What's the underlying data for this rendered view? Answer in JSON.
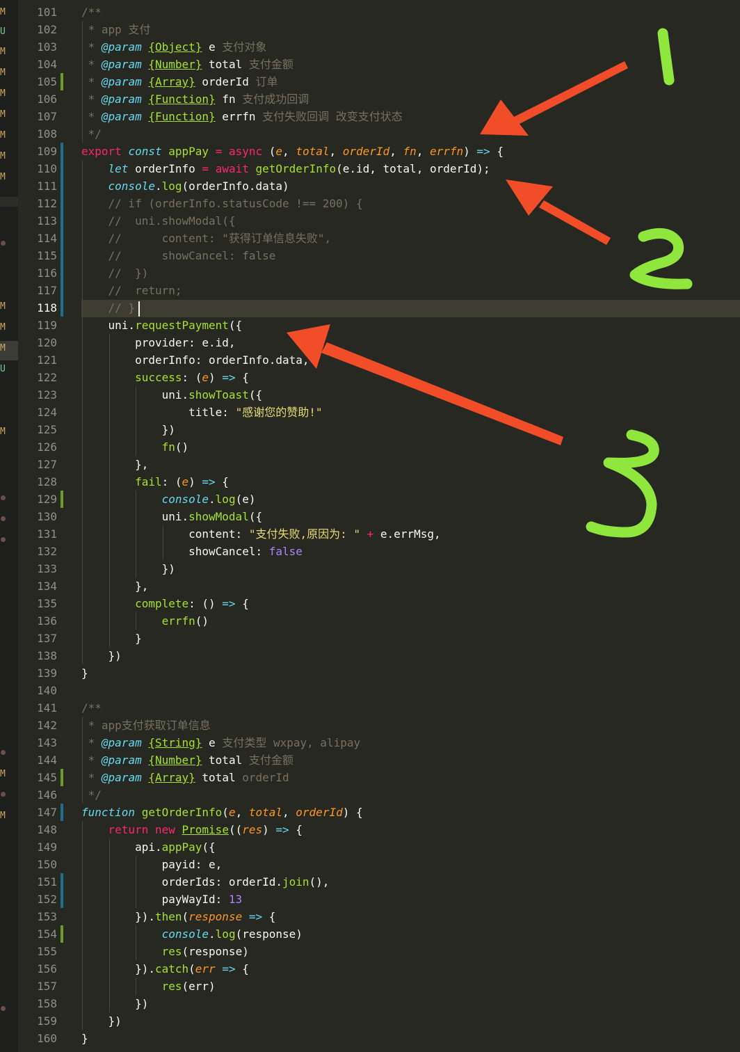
{
  "editor": {
    "active_line": 118,
    "accent_colors": {
      "background": "#272822",
      "keyword": "#f92672",
      "storage": "#66d9ef",
      "function": "#a6e22e",
      "parameter": "#fd971f",
      "string": "#e6db74",
      "number": "#ae81ff",
      "comment": "#75715e"
    },
    "lines": [
      {
        "n": 101,
        "t": [
          [
            "/**",
            "cm"
          ]
        ]
      },
      {
        "n": 102,
        "t": [
          [
            " * app 支付",
            "cm"
          ]
        ]
      },
      {
        "n": 103,
        "t": [
          [
            " * ",
            "cm"
          ],
          [
            "@param",
            "st"
          ],
          [
            " ",
            ""
          ],
          [
            "{Object}",
            "ty"
          ],
          [
            " e ",
            ""
          ],
          [
            "支付对象",
            "cm"
          ]
        ]
      },
      {
        "n": 104,
        "t": [
          [
            " * ",
            "cm"
          ],
          [
            "@param",
            "st"
          ],
          [
            " ",
            ""
          ],
          [
            "{Number}",
            "ty"
          ],
          [
            " total ",
            ""
          ],
          [
            "支付金额",
            "cm"
          ]
        ]
      },
      {
        "n": 105,
        "t": [
          [
            " * ",
            "cm"
          ],
          [
            "@param",
            "st"
          ],
          [
            " ",
            ""
          ],
          [
            "{Array}",
            "ty"
          ],
          [
            " orderId ",
            ""
          ],
          [
            "订单",
            "cm"
          ]
        ]
      },
      {
        "n": 106,
        "t": [
          [
            " * ",
            "cm"
          ],
          [
            "@param",
            "st"
          ],
          [
            " ",
            ""
          ],
          [
            "{Function}",
            "ty"
          ],
          [
            " fn ",
            ""
          ],
          [
            "支付成功回调",
            "cm"
          ]
        ]
      },
      {
        "n": 107,
        "t": [
          [
            " * ",
            "cm"
          ],
          [
            "@param",
            "st"
          ],
          [
            " ",
            ""
          ],
          [
            "{Function}",
            "ty"
          ],
          [
            " errfn ",
            ""
          ],
          [
            "支付失败回调 改变支付状态",
            "cm"
          ]
        ]
      },
      {
        "n": 108,
        "t": [
          [
            " */",
            "cm"
          ]
        ]
      },
      {
        "n": 109,
        "t": [
          [
            "export",
            "kw"
          ],
          [
            " ",
            ""
          ],
          [
            "const",
            "st"
          ],
          [
            " ",
            ""
          ],
          [
            "appPay",
            "fn"
          ],
          [
            " ",
            ""
          ],
          [
            "=",
            "kw"
          ],
          [
            " ",
            ""
          ],
          [
            "async",
            "kw"
          ],
          [
            " (",
            ""
          ],
          [
            "e",
            "pa"
          ],
          [
            ", ",
            ""
          ],
          [
            "total",
            "pa"
          ],
          [
            ", ",
            ""
          ],
          [
            "orderId",
            "pa"
          ],
          [
            ", ",
            ""
          ],
          [
            "fn",
            "pa"
          ],
          [
            ", ",
            ""
          ],
          [
            "errfn",
            "pa"
          ],
          [
            ") ",
            ""
          ],
          [
            "=>",
            "st"
          ],
          [
            " {",
            ""
          ]
        ]
      },
      {
        "n": 110,
        "t": [
          [
            "    ",
            ""
          ],
          [
            "let",
            "st"
          ],
          [
            " orderInfo ",
            ""
          ],
          [
            "=",
            "kw"
          ],
          [
            " ",
            ""
          ],
          [
            "await",
            "kw"
          ],
          [
            " ",
            ""
          ],
          [
            "getOrderInfo",
            "fn"
          ],
          [
            "(e.id, total, orderId);",
            ""
          ]
        ]
      },
      {
        "n": 111,
        "t": [
          [
            "    ",
            ""
          ],
          [
            "console",
            "st"
          ],
          [
            ".",
            ""
          ],
          [
            "log",
            "fn"
          ],
          [
            "(orderInfo.data)",
            ""
          ]
        ]
      },
      {
        "n": 112,
        "t": [
          [
            "    // if (orderInfo.statusCode !== 200) {",
            "cm"
          ]
        ]
      },
      {
        "n": 113,
        "t": [
          [
            "    //  uni.showModal({",
            "cm"
          ]
        ]
      },
      {
        "n": 114,
        "t": [
          [
            "    //      content: \"获得订单信息失败\",",
            "cm"
          ]
        ]
      },
      {
        "n": 115,
        "t": [
          [
            "    //      showCancel: false",
            "cm"
          ]
        ]
      },
      {
        "n": 116,
        "t": [
          [
            "    //  })",
            "cm"
          ]
        ]
      },
      {
        "n": 117,
        "t": [
          [
            "    //  return;",
            "cm"
          ]
        ]
      },
      {
        "n": 118,
        "t": [
          [
            "    // }",
            "cm"
          ]
        ]
      },
      {
        "n": 119,
        "t": [
          [
            "    uni.",
            ""
          ],
          [
            "requestPayment",
            "fn"
          ],
          [
            "({",
            ""
          ]
        ]
      },
      {
        "n": 120,
        "t": [
          [
            "        provider: e.id,",
            ""
          ]
        ]
      },
      {
        "n": 121,
        "t": [
          [
            "        orderInfo: orderInfo.data,",
            ""
          ]
        ]
      },
      {
        "n": 122,
        "t": [
          [
            "        ",
            ""
          ],
          [
            "success",
            "fn"
          ],
          [
            ": (",
            ""
          ],
          [
            "e",
            "pa"
          ],
          [
            ") ",
            ""
          ],
          [
            "=>",
            "st"
          ],
          [
            " {",
            ""
          ]
        ]
      },
      {
        "n": 123,
        "t": [
          [
            "            uni.",
            ""
          ],
          [
            "showToast",
            "fn"
          ],
          [
            "({",
            ""
          ]
        ]
      },
      {
        "n": 124,
        "t": [
          [
            "                title: ",
            ""
          ],
          [
            "\"感谢您的赞助!\"",
            "str"
          ]
        ]
      },
      {
        "n": 125,
        "t": [
          [
            "            })",
            ""
          ]
        ]
      },
      {
        "n": 126,
        "t": [
          [
            "            ",
            ""
          ],
          [
            "fn",
            "fn"
          ],
          [
            "()",
            ""
          ]
        ]
      },
      {
        "n": 127,
        "t": [
          [
            "        },",
            ""
          ]
        ]
      },
      {
        "n": 128,
        "t": [
          [
            "        ",
            ""
          ],
          [
            "fail",
            "fn"
          ],
          [
            ": (",
            ""
          ],
          [
            "e",
            "pa"
          ],
          [
            ") ",
            ""
          ],
          [
            "=>",
            "st"
          ],
          [
            " {",
            ""
          ]
        ]
      },
      {
        "n": 129,
        "t": [
          [
            "            ",
            ""
          ],
          [
            "console",
            "st"
          ],
          [
            ".",
            ""
          ],
          [
            "log",
            "fn"
          ],
          [
            "(e)",
            ""
          ]
        ]
      },
      {
        "n": 130,
        "t": [
          [
            "            uni.",
            ""
          ],
          [
            "showModal",
            "fn"
          ],
          [
            "({",
            ""
          ]
        ]
      },
      {
        "n": 131,
        "t": [
          [
            "                content: ",
            ""
          ],
          [
            "\"支付失败,原因为: \"",
            "str"
          ],
          [
            " ",
            ""
          ],
          [
            "+",
            "kw"
          ],
          [
            " e.errMsg,",
            ""
          ]
        ]
      },
      {
        "n": 132,
        "t": [
          [
            "                showCancel: ",
            ""
          ],
          [
            "false",
            "num"
          ]
        ]
      },
      {
        "n": 133,
        "t": [
          [
            "            })",
            ""
          ]
        ]
      },
      {
        "n": 134,
        "t": [
          [
            "        },",
            ""
          ]
        ]
      },
      {
        "n": 135,
        "t": [
          [
            "        ",
            ""
          ],
          [
            "complete",
            "fn"
          ],
          [
            ": () ",
            ""
          ],
          [
            "=>",
            "st"
          ],
          [
            " {",
            ""
          ]
        ]
      },
      {
        "n": 136,
        "t": [
          [
            "            ",
            ""
          ],
          [
            "errfn",
            "fn"
          ],
          [
            "()",
            ""
          ]
        ]
      },
      {
        "n": 137,
        "t": [
          [
            "        }",
            ""
          ]
        ]
      },
      {
        "n": 138,
        "t": [
          [
            "    })",
            ""
          ]
        ]
      },
      {
        "n": 139,
        "t": [
          [
            "}",
            ""
          ]
        ]
      },
      {
        "n": 140,
        "t": []
      },
      {
        "n": 141,
        "t": [
          [
            "/**",
            "cm"
          ]
        ]
      },
      {
        "n": 142,
        "t": [
          [
            " * app支付获取订单信息",
            "cm"
          ]
        ]
      },
      {
        "n": 143,
        "t": [
          [
            " * ",
            "cm"
          ],
          [
            "@param",
            "st"
          ],
          [
            " ",
            ""
          ],
          [
            "{String}",
            "ty"
          ],
          [
            " e ",
            ""
          ],
          [
            "支付类型 wxpay, alipay",
            "cm"
          ]
        ]
      },
      {
        "n": 144,
        "t": [
          [
            " * ",
            "cm"
          ],
          [
            "@param",
            "st"
          ],
          [
            " ",
            ""
          ],
          [
            "{Number}",
            "ty"
          ],
          [
            " total ",
            ""
          ],
          [
            "支付金额",
            "cm"
          ]
        ]
      },
      {
        "n": 145,
        "t": [
          [
            " * ",
            "cm"
          ],
          [
            "@param",
            "st"
          ],
          [
            " ",
            ""
          ],
          [
            "{Array}",
            "ty"
          ],
          [
            " total ",
            ""
          ],
          [
            "orderId",
            "cm"
          ]
        ]
      },
      {
        "n": 146,
        "t": [
          [
            " */",
            "cm"
          ]
        ]
      },
      {
        "n": 147,
        "t": [
          [
            "function",
            "st"
          ],
          [
            " ",
            ""
          ],
          [
            "getOrderInfo",
            "fn"
          ],
          [
            "(",
            ""
          ],
          [
            "e",
            "pa"
          ],
          [
            ", ",
            ""
          ],
          [
            "total",
            "pa"
          ],
          [
            ", ",
            ""
          ],
          [
            "orderId",
            "pa"
          ],
          [
            ") {",
            ""
          ]
        ]
      },
      {
        "n": 148,
        "t": [
          [
            "    ",
            ""
          ],
          [
            "return",
            "kw"
          ],
          [
            " ",
            ""
          ],
          [
            "new",
            "kw"
          ],
          [
            " ",
            ""
          ],
          [
            "Promise",
            "cls"
          ],
          [
            "((",
            ""
          ],
          [
            "res",
            "pa"
          ],
          [
            ") ",
            ""
          ],
          [
            "=>",
            "st"
          ],
          [
            " {",
            ""
          ]
        ]
      },
      {
        "n": 149,
        "t": [
          [
            "        api.",
            ""
          ],
          [
            "appPay",
            "fn"
          ],
          [
            "({",
            ""
          ]
        ]
      },
      {
        "n": 150,
        "t": [
          [
            "            payid: e,",
            ""
          ]
        ]
      },
      {
        "n": 151,
        "t": [
          [
            "            orderIds: orderId.",
            ""
          ],
          [
            "join",
            "fn"
          ],
          [
            "(),",
            ""
          ]
        ]
      },
      {
        "n": 152,
        "t": [
          [
            "            payWayId: ",
            ""
          ],
          [
            "13",
            "num"
          ]
        ]
      },
      {
        "n": 153,
        "t": [
          [
            "        }).",
            ""
          ],
          [
            "then",
            "fn"
          ],
          [
            "(",
            ""
          ],
          [
            "response",
            "pa"
          ],
          [
            " ",
            ""
          ],
          [
            "=>",
            "st"
          ],
          [
            " {",
            ""
          ]
        ]
      },
      {
        "n": 154,
        "t": [
          [
            "            ",
            ""
          ],
          [
            "console",
            "st"
          ],
          [
            ".",
            ""
          ],
          [
            "log",
            "fn"
          ],
          [
            "(response)",
            ""
          ]
        ]
      },
      {
        "n": 155,
        "t": [
          [
            "            ",
            ""
          ],
          [
            "res",
            "fn"
          ],
          [
            "(response)",
            ""
          ]
        ]
      },
      {
        "n": 156,
        "t": [
          [
            "        }).",
            ""
          ],
          [
            "catch",
            "fn"
          ],
          [
            "(",
            ""
          ],
          [
            "err",
            "pa"
          ],
          [
            " ",
            ""
          ],
          [
            "=>",
            "st"
          ],
          [
            " {",
            ""
          ]
        ]
      },
      {
        "n": 157,
        "t": [
          [
            "            ",
            ""
          ],
          [
            "res",
            "fn"
          ],
          [
            "(err)",
            ""
          ]
        ]
      },
      {
        "n": 158,
        "t": [
          [
            "        })",
            ""
          ]
        ]
      },
      {
        "n": 159,
        "t": [
          [
            "    })",
            ""
          ]
        ]
      },
      {
        "n": 160,
        "t": [
          [
            "}",
            ""
          ]
        ]
      }
    ]
  },
  "git_markers": [
    {
      "label": "M",
      "color": "#c9a55b"
    },
    {
      "label": "U",
      "color": "#73c991"
    },
    {
      "label": "M",
      "color": "#c9a55b"
    },
    {
      "label": "M",
      "color": "#c9a55b"
    },
    {
      "label": "M",
      "color": "#c9a55b"
    },
    {
      "label": "M",
      "color": "#c9a55b"
    },
    {
      "label": "M",
      "color": "#c9a55b"
    },
    {
      "label": "M",
      "color": "#c9a55b"
    },
    {
      "label": "M",
      "color": "#c9a55b"
    },
    {
      "label": "M",
      "color": "#c9a55b"
    },
    {
      "label": "M",
      "color": "#c9a55b"
    },
    {
      "label": "M",
      "color": "#c9a55b"
    },
    {
      "label": "U",
      "color": "#73c991"
    },
    {
      "label": "M",
      "color": "#c9a55b"
    },
    {
      "label": "M",
      "color": "#c9a55b"
    },
    {
      "label": "M",
      "color": "#c9a55b"
    }
  ],
  "annotations": {
    "numbers": [
      "1",
      "2",
      "3"
    ],
    "number_color": "#8fe63c",
    "arrow_color": "#f04d28"
  }
}
